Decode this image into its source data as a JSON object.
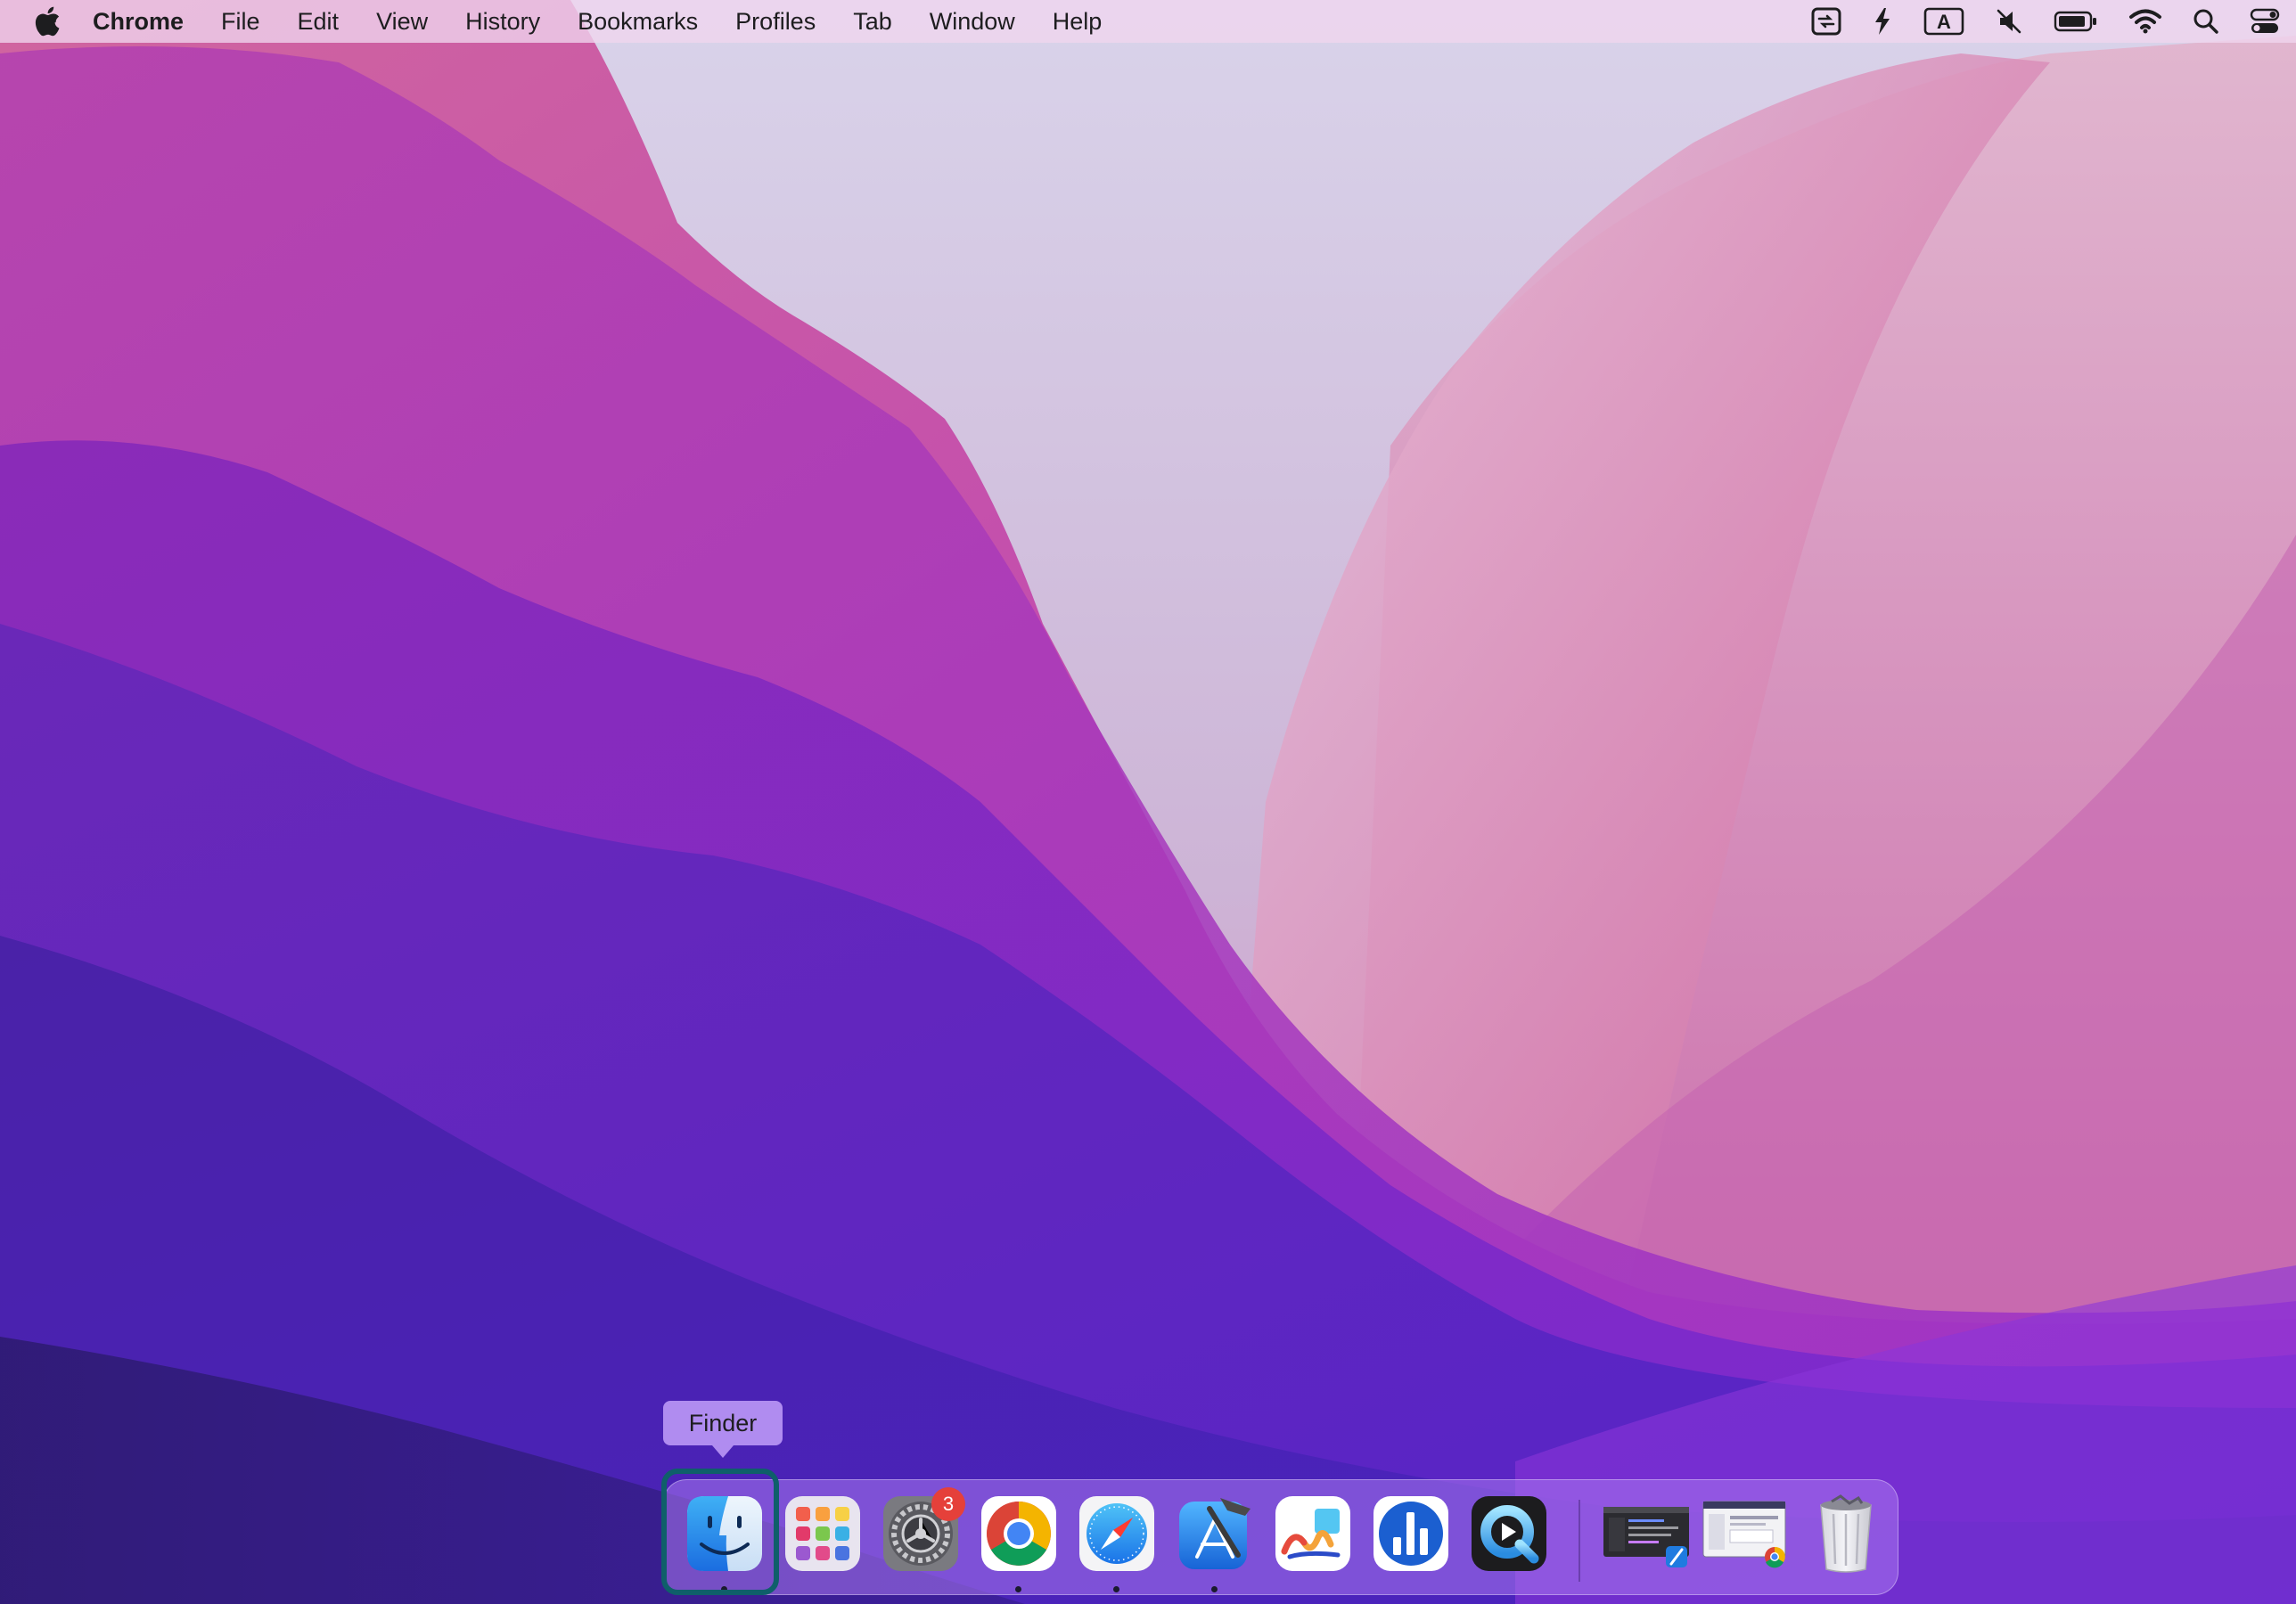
{
  "menubar": {
    "app_name": "Chrome",
    "items": [
      "File",
      "Edit",
      "View",
      "History",
      "Bookmarks",
      "Profiles",
      "Tab",
      "Window",
      "Help"
    ],
    "keyboard_input_label": "A",
    "status_icons": [
      "screen-share-icon",
      "pen-tool-icon",
      "input-source-icon",
      "sound-muted-icon",
      "battery-icon",
      "wifi-icon",
      "spotlight-search-icon",
      "control-center-icon"
    ]
  },
  "dock": {
    "tooltip": "Finder",
    "system_preferences_badge": "3",
    "apps": [
      {
        "name": "Finder",
        "icon": "finder-icon",
        "running": true
      },
      {
        "name": "Launchpad",
        "icon": "launchpad-icon",
        "running": false
      },
      {
        "name": "System Preferences",
        "icon": "system-preferences-icon",
        "running": false
      },
      {
        "name": "Google Chrome",
        "icon": "chrome-icon",
        "running": true
      },
      {
        "name": "Safari",
        "icon": "safari-icon",
        "running": true
      },
      {
        "name": "Xcode",
        "icon": "xcode-icon",
        "running": true
      },
      {
        "name": "Freeform",
        "icon": "freeform-icon",
        "running": false
      },
      {
        "name": "Instruments",
        "icon": "instruments-icon",
        "running": false
      },
      {
        "name": "QuickTime Player",
        "icon": "quicktime-icon",
        "running": false
      }
    ],
    "recent_windows": [
      "xcode-window-thumbnail",
      "chrome-window-thumbnail"
    ],
    "trash": "trash-icon"
  },
  "colors": {
    "menubar": "#f0d6ee",
    "dock_focus": "#0f5f6a",
    "badge": "#e5403a",
    "tooltip": "#b996f5"
  }
}
